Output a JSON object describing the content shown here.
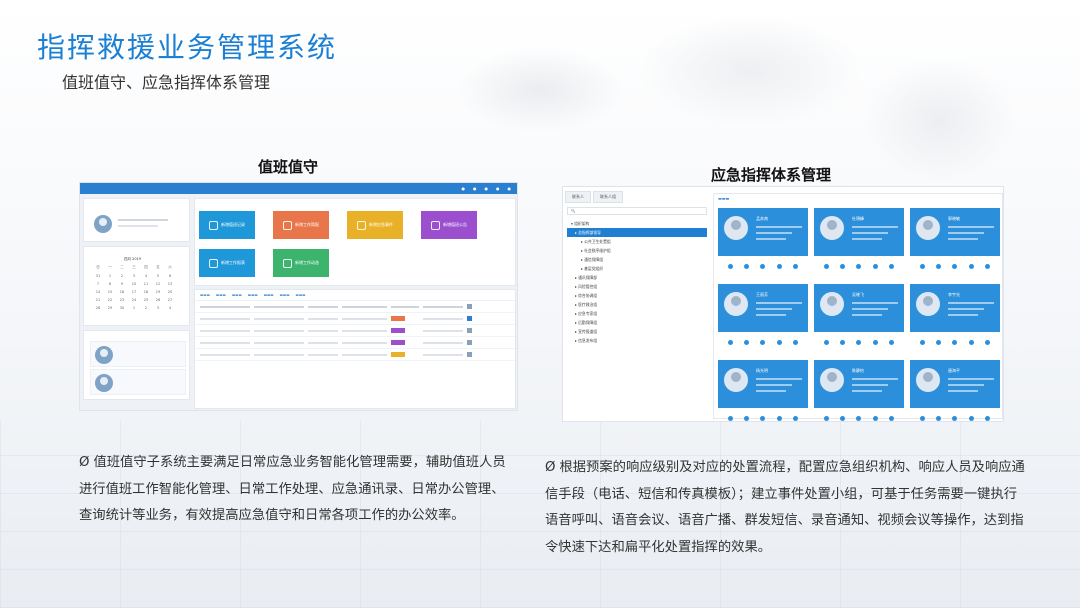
{
  "title": "指挥救援业务管理系统",
  "subtitle": "值班值守、应急指挥体系管理",
  "left": {
    "label": "值班值守",
    "screenshot": {
      "tiles": [
        {
          "label": "新增值班记录",
          "color": "#1e98d8"
        },
        {
          "label": "新增工作简报",
          "color": "#e8764a"
        },
        {
          "label": "新增应急事件",
          "color": "#e9b128"
        },
        {
          "label": "新增值班公告",
          "color": "#9b4fcf"
        },
        {
          "label": "新增工作报表",
          "color": "#1e98d8"
        },
        {
          "label": "新增工作动态",
          "color": "#3db46d"
        }
      ],
      "calendar_title": "四月 2019",
      "calendar_days": [
        "日",
        "一",
        "二",
        "三",
        "四",
        "五",
        "六",
        "31",
        "1",
        "2",
        "3",
        "4",
        "5",
        "6",
        "7",
        "8",
        "9",
        "10",
        "11",
        "12",
        "13",
        "14",
        "15",
        "16",
        "17",
        "18",
        "19",
        "20",
        "21",
        "22",
        "23",
        "24",
        "25",
        "26",
        "27",
        "28",
        "29",
        "30",
        "1",
        "2",
        "3",
        "4"
      ]
    },
    "description": "值班值守子系统主要满足日常应急业务智能化管理需要，辅助值班人员进行值班工作智能化管理、日常工作处理、应急通讯录、日常办公管理、查询统计等业务，有效提高应急值守和日常各项工作的办公效率。"
  },
  "right": {
    "label": "应急指挥体系管理",
    "screenshot": {
      "tabs": [
        "联系人",
        "联系人组"
      ],
      "tree": [
        "组织架构",
        "总指挥部领导",
        "公共卫生处置组",
        "社会秩序维护组",
        "通信保障组",
        "基层党组织",
        "通讯保障部",
        "风险管控组",
        "综合协调组",
        "医疗救治组",
        "应急专家组",
        "后勤保障组",
        "宣传报道组",
        "信息发布组"
      ],
      "cards": [
        "孟苏南",
        "杜锦峰",
        "郭晓敏",
        "王丽芳",
        "吴晓飞",
        "李宇光",
        "杨光明",
        "陈静怡",
        "唐海平"
      ]
    },
    "description": "根据预案的响应级别及对应的处置流程，配置应急组织机构、响应人员及响应通信手段（电话、短信和传真模板）；建立事件处置小组，可基于任务需要一键执行语音呼叫、语音会议、语音广播、群发短信、录音通知、视频会议等操作，达到指令快速下达和扁平化处置指挥的效果。"
  },
  "bullet_mark": "Ø"
}
